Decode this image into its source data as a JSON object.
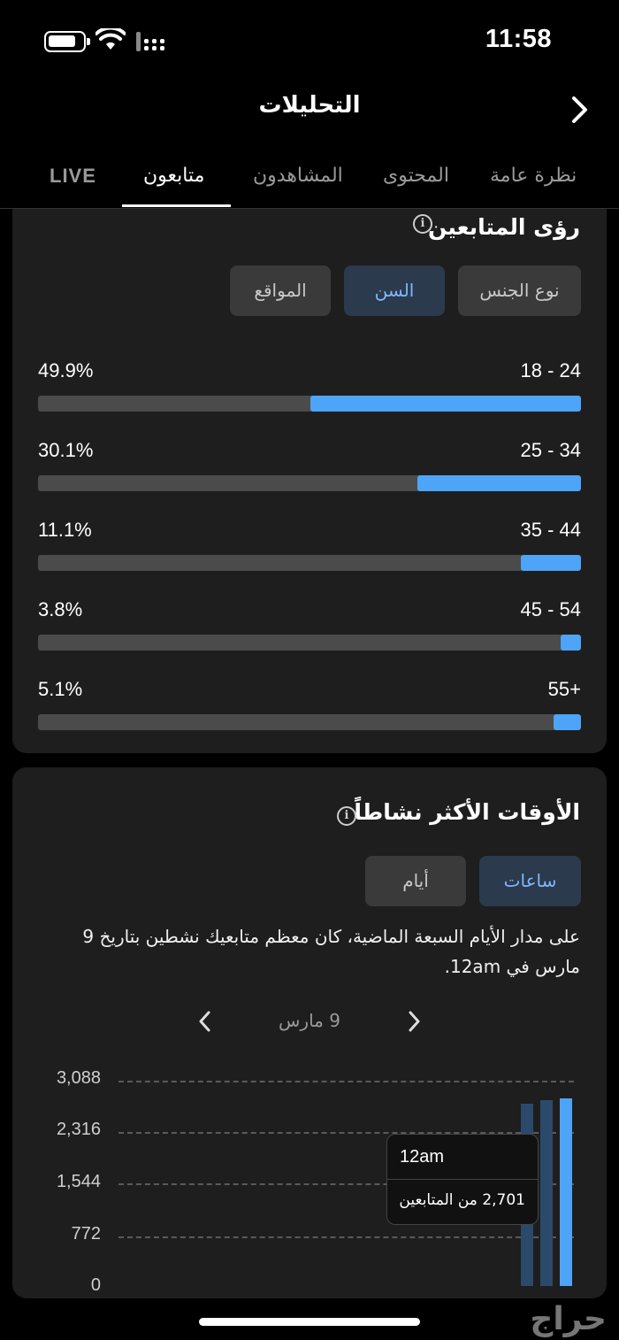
{
  "status_bar": {
    "time": "11:58"
  },
  "header": {
    "title": "التحليلات"
  },
  "tabs": [
    {
      "label": "نظرة عامة"
    },
    {
      "label": "المحتوى"
    },
    {
      "label": "المشاهدون"
    },
    {
      "label": "متابعون"
    },
    {
      "label": "LIVE"
    }
  ],
  "follower_insights": {
    "title": "رؤى المتابعين",
    "segments": [
      {
        "label": "نوع الجنس"
      },
      {
        "label": "السن"
      },
      {
        "label": "المواقع"
      }
    ],
    "active_segment": "السن",
    "age_groups": [
      {
        "range": "24 - 18",
        "percent": "49.9%",
        "value": 49.9
      },
      {
        "range": "34 - 25",
        "percent": "30.1%",
        "value": 30.1
      },
      {
        "range": "44 - 35",
        "percent": "11.1%",
        "value": 11.1
      },
      {
        "range": "54 - 45",
        "percent": "3.8%",
        "value": 3.8
      },
      {
        "range": "+55",
        "percent": "5.1%",
        "value": 5.1
      }
    ]
  },
  "active_times": {
    "title": "الأوقات الأكثر نشاطاً",
    "segments": [
      {
        "label": "ساعات"
      },
      {
        "label": "أيام"
      }
    ],
    "active_segment": "ساعات",
    "description": "على مدار الأيام السبعة الماضية، كان معظم متابعيك نشطين بتاريخ 9 مارس في 12am.",
    "date_label": "9 مارس",
    "y_ticks": [
      "3,088",
      "2,316",
      "1,544",
      "772",
      "0"
    ],
    "tooltip": {
      "time": "12am",
      "value_text": "2,701 من المتابعين"
    }
  },
  "watermark": "حراج",
  "colors": {
    "accent": "#4ea4f7",
    "card": "#1e1e1e",
    "track": "#4b4b4b"
  }
}
